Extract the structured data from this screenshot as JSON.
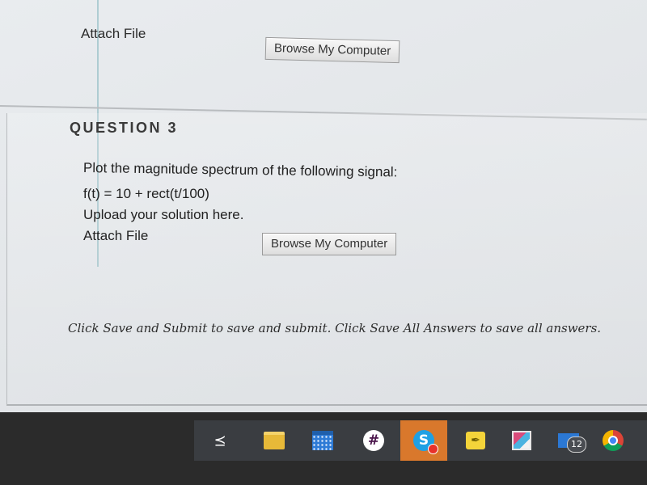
{
  "previous_question": {
    "attach_label": "Attach File",
    "browse_label": "Browse My Computer"
  },
  "question": {
    "title": "QUESTION 3",
    "prompt_lines": [
      "Plot the magnitude spectrum of the following signal:",
      "f(t) = 10 + rect(t/100)",
      "Upload your solution here."
    ],
    "attach_label": "Attach File",
    "browse_label": "Browse My Computer"
  },
  "footer": {
    "instructions": "Click Save and Submit to save and submit. Click Save All Answers to save all answers."
  },
  "taskbar": {
    "icons": [
      "task-view-icon",
      "file-explorer-icon",
      "calendar-icon",
      "slack-icon",
      "skype-icon",
      "sticky-notes-icon",
      "snip-sketch-icon",
      "mail-icon",
      "chrome-icon"
    ],
    "mail_badge_count": "12",
    "skype_tile_color": "#d9782c"
  }
}
